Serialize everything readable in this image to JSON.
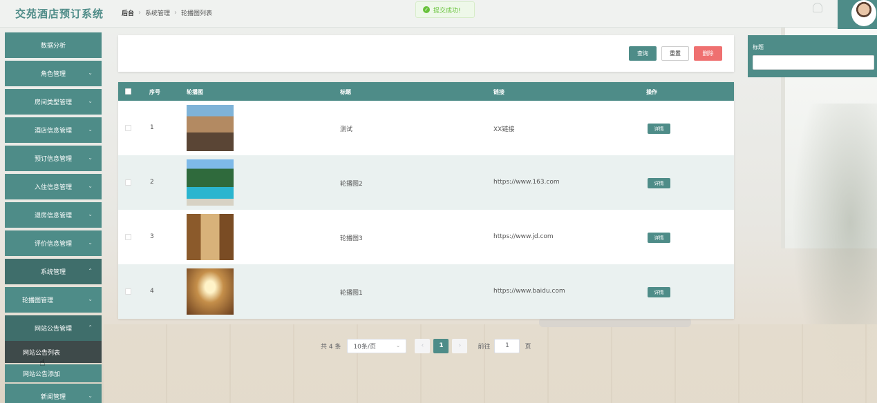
{
  "app": {
    "title": "交苑酒店预订系统"
  },
  "breadcrumb": [
    "后台",
    "系统管理",
    "轮播图列表"
  ],
  "toast": {
    "message": "提交成功!"
  },
  "sidebar": {
    "items": [
      {
        "label": "数据分析"
      },
      {
        "label": "角色管理"
      },
      {
        "label": "房间类型管理"
      },
      {
        "label": "酒店信息管理"
      },
      {
        "label": "预订信息管理"
      },
      {
        "label": "入住信息管理"
      },
      {
        "label": "退房信息管理"
      },
      {
        "label": "评价信息管理"
      },
      {
        "label": "系统管理"
      },
      {
        "label": "轮播图管理"
      },
      {
        "label": "网站公告管理"
      },
      {
        "label": "新闻管理"
      }
    ],
    "sub_items": [
      "网站公告列表",
      "网站公告添加"
    ]
  },
  "toolbar": {
    "search_label": "查询",
    "reset_label": "重置",
    "delete_label": "删除"
  },
  "filter": {
    "title_label": "标题",
    "title_value": ""
  },
  "table": {
    "headers": {
      "index": "序号",
      "image": "轮播图",
      "title": "标题",
      "link": "链接",
      "action": "操作"
    },
    "rows": [
      {
        "index": "1",
        "image": "resort-pool",
        "title": "测试",
        "link": "XX链接",
        "action": "详情"
      },
      {
        "index": "2",
        "image": "villa-pool",
        "title": "轮播图2",
        "link": "https://www.163.com",
        "action": "详情"
      },
      {
        "index": "3",
        "image": "hotel-lounge",
        "title": "轮播图3",
        "link": "https://www.jd.com",
        "action": "详情"
      },
      {
        "index": "4",
        "image": "hotel-hallway",
        "title": "轮播图1",
        "link": "https://www.baidu.com",
        "action": "详情"
      }
    ]
  },
  "pagination": {
    "total_text": "共 4 条",
    "page_size": "10条/页",
    "prev": "‹",
    "current": "1",
    "next": "›",
    "goto_label": "前往",
    "goto_value": "1",
    "page_unit": "页"
  },
  "colors": {
    "accent": "#4e8c88",
    "danger": "#ef7070",
    "success": "#67c23a"
  },
  "icons": {
    "toast": "check-circle-icon",
    "notification": "bell-icon",
    "submenu": "chevron-down-icon"
  }
}
